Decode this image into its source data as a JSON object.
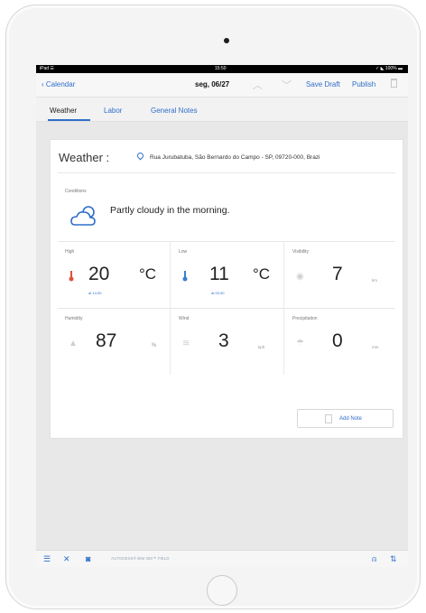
{
  "status_bar": {
    "carrier": "iPad ☰",
    "time": "15:50",
    "battery": "✓ ◣ 100% ▬"
  },
  "nav": {
    "back_label": "Calendar",
    "date": "seg, 06/27",
    "up_arrow": "︿",
    "down_arrow": "﹀",
    "save_draft": "Save Draft",
    "publish": "Publish"
  },
  "tabs": [
    {
      "label": "Weather"
    },
    {
      "label": "Labor"
    },
    {
      "label": "General Notes"
    }
  ],
  "weather": {
    "title": "Weather :",
    "address": "Rua Jurubatuba, São Bernardo do Campo - SP, 09720-000, Brazi",
    "conditions_label": "Conditions",
    "conditions_text": "Partly cloudy in the morning."
  },
  "metrics": {
    "high": {
      "label": "High",
      "value": "20",
      "unit": "°C",
      "sub": "at 14:30"
    },
    "low": {
      "label": "Low",
      "value": "11",
      "unit": "°C",
      "sub": "at 03:30"
    },
    "visibility": {
      "label": "Visibility",
      "value": "7",
      "unit": "km"
    },
    "humidity": {
      "label": "Humidity",
      "value": "87",
      "unit": "%"
    },
    "wind": {
      "label": "Wind",
      "value": "3",
      "unit": "kph"
    },
    "precipitation": {
      "label": "Precipitation",
      "value": "0",
      "unit": "mm"
    }
  },
  "add_note": "Add Note",
  "toolbar": {
    "brand": "AUTODESK® BIM 360™ FIELD"
  },
  "colors": {
    "accent": "#2f6ec9",
    "thermo_high": "#e0523c",
    "thermo_low": "#3a7fd5"
  }
}
